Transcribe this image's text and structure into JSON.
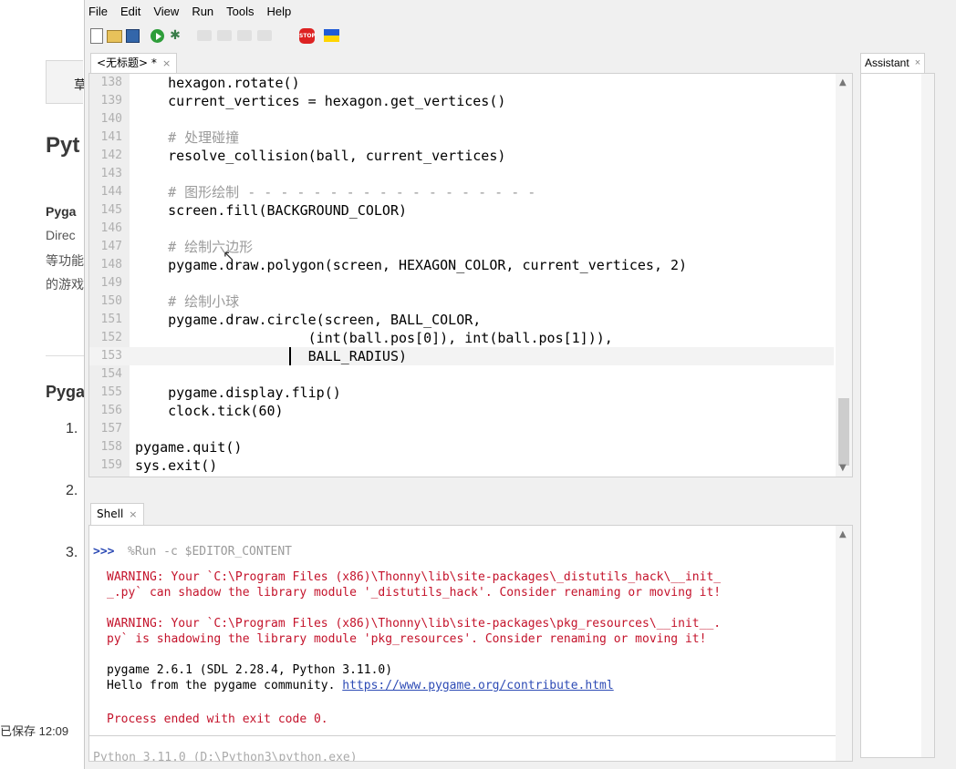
{
  "background_page": {
    "button_text": "草",
    "heading": "Pyt",
    "para_lines": [
      "Pyga",
      "Direc",
      "等功能",
      "的游戏"
    ],
    "subheading": "Pyga",
    "numbers": [
      "1.",
      "2.",
      "3."
    ],
    "saved_status": "已保存 12:09"
  },
  "menu": [
    "File",
    "Edit",
    "View",
    "Run",
    "Tools",
    "Help"
  ],
  "toolbar": {
    "items": [
      "new-file-icon",
      "open-file-icon",
      "save-icon",
      "run-icon",
      "debug-icon",
      "step-over-icon",
      "step-into-icon",
      "step-out-icon",
      "resume-icon",
      "stop-icon",
      "ukraine-flag-icon"
    ],
    "stop_label": "STOP"
  },
  "editor": {
    "tab_title": "<无标题> *",
    "tab_close": "×",
    "current_line": "153",
    "lines": [
      {
        "n": "138",
        "text": "    hexagon.rotate()",
        "comment": false
      },
      {
        "n": "139",
        "text": "    current_vertices = hexagon.get_vertices()",
        "comment": false
      },
      {
        "n": "140",
        "text": "",
        "comment": false
      },
      {
        "n": "141",
        "text": "    # 处理碰撞",
        "comment": true
      },
      {
        "n": "142",
        "text": "    resolve_collision(ball, current_vertices)",
        "comment": false
      },
      {
        "n": "143",
        "text": "",
        "comment": false
      },
      {
        "n": "144",
        "text": "    # 图形绘制 - - - - - - - - - - - - - - - - - -",
        "comment": true
      },
      {
        "n": "145",
        "text": "    screen.fill(BACKGROUND_COLOR)",
        "comment": false
      },
      {
        "n": "146",
        "text": "",
        "comment": false
      },
      {
        "n": "147",
        "text": "    # 绘制六边形",
        "comment": true
      },
      {
        "n": "148",
        "text": "    pygame.draw.polygon(screen, HEXAGON_COLOR, current_vertices, 2)",
        "comment": false
      },
      {
        "n": "149",
        "text": "",
        "comment": false
      },
      {
        "n": "150",
        "text": "    # 绘制小球",
        "comment": true
      },
      {
        "n": "151",
        "text": "    pygame.draw.circle(screen, BALL_COLOR,",
        "comment": false
      },
      {
        "n": "152",
        "text": "                     (int(ball.pos[0]), int(ball.pos[1])),",
        "comment": false
      },
      {
        "n": "153",
        "text": "                     BALL_RADIUS)",
        "comment": false
      },
      {
        "n": "154",
        "text": "",
        "comment": false
      },
      {
        "n": "155",
        "text": "    pygame.display.flip()",
        "comment": false
      },
      {
        "n": "156",
        "text": "    clock.tick(60)",
        "comment": false
      },
      {
        "n": "157",
        "text": "",
        "comment": false
      },
      {
        "n": "158",
        "text": "pygame.quit()",
        "comment": false
      },
      {
        "n": "159",
        "text": "sys.exit()",
        "comment": false
      }
    ]
  },
  "shell": {
    "tab_title": "Shell",
    "tab_close": "×",
    "prompt": ">>>",
    "command": "%Run -c $EDITOR_CONTENT",
    "warning1_line1": "WARNING: Your `C:\\Program Files (x86)\\Thonny\\lib\\site-packages\\_distutils_hack\\__init_",
    "warning1_line2": "_.py` can shadow the library module '_distutils_hack'. Consider renaming or moving it!",
    "warning2_line1": "WARNING: Your `C:\\Program Files (x86)\\Thonny\\lib\\site-packages\\pkg_resources\\__init__.",
    "warning2_line2": "py` is shadowing the library module 'pkg_resources'. Consider renaming or moving it!",
    "pygame_version": "pygame 2.6.1 (SDL 2.28.4, Python 3.11.0)",
    "hello_text": "Hello from the pygame community. ",
    "hello_link": "https://www.pygame.org/contribute.html",
    "process_ended": "Process ended with exit code 0.",
    "interpreter_status": "Python 3.11.0 (D:\\Python3\\python.exe)"
  },
  "assistant": {
    "tab_title": "Assistant",
    "tab_close": "×"
  },
  "colors": {
    "comment": "#9a9a9a",
    "warning": "#c4132b",
    "prompt": "#2d4bb5",
    "link": "#2d4bb5"
  }
}
